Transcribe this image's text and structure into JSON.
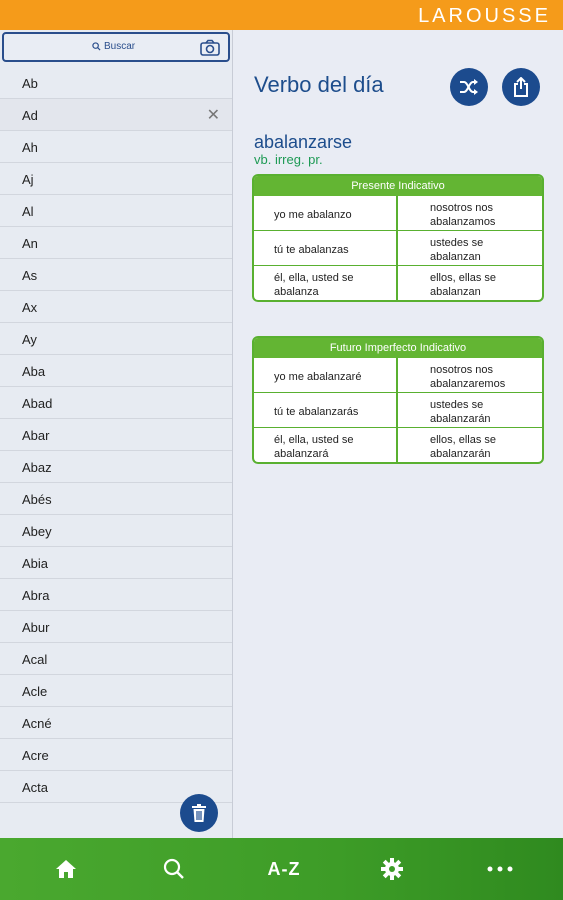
{
  "header": {
    "brand": "LAROUSSE"
  },
  "search": {
    "placeholder": "Buscar"
  },
  "sidebar": {
    "items": [
      {
        "label": "Ab"
      },
      {
        "label": "Ad"
      },
      {
        "label": "Ah"
      },
      {
        "label": "Aj"
      },
      {
        "label": "Al"
      },
      {
        "label": "An"
      },
      {
        "label": "As"
      },
      {
        "label": "Ax"
      },
      {
        "label": "Ay"
      },
      {
        "label": "Aba"
      },
      {
        "label": "Abad"
      },
      {
        "label": "Abar"
      },
      {
        "label": "Abaz"
      },
      {
        "label": "Abés"
      },
      {
        "label": "Abey"
      },
      {
        "label": "Abia"
      },
      {
        "label": "Abra"
      },
      {
        "label": "Abur"
      },
      {
        "label": "Acal"
      },
      {
        "label": "Acle"
      },
      {
        "label": "Acné"
      },
      {
        "label": "Acre"
      },
      {
        "label": "Acta"
      }
    ]
  },
  "main": {
    "title": "Verbo del día",
    "word": "abalanzarse",
    "grammar": "vb. irreg. pr.",
    "tables": [
      {
        "header": "Presente Indicativo",
        "rows": [
          [
            "yo me abalanzo",
            "nosotros nos abalanzamos"
          ],
          [
            "tú te abalanzas",
            "ustedes se abalanzan"
          ],
          [
            "él, ella, usted se abalanza",
            "ellos, ellas se abalanzan"
          ]
        ]
      },
      {
        "header": "Futuro Imperfecto Indicativo",
        "rows": [
          [
            "yo me abalanzaré",
            "nosotros nos abalanzaremos"
          ],
          [
            "tú te abalanzarás",
            "ustedes se abalanzarán"
          ],
          [
            "él, ella, usted se abalanzará",
            "ellos, ellas se abalanzarán"
          ]
        ]
      }
    ]
  },
  "nav": {
    "az_label": "A-Z"
  },
  "icons": [
    "search-icon",
    "camera-icon",
    "close-icon",
    "trash-icon",
    "shuffle-icon",
    "share-icon",
    "home-icon",
    "gear-icon",
    "more-icon"
  ],
  "colors": {
    "brand_orange": "#f59b1a",
    "primary_blue": "#1c4b8e",
    "accent_green": "#63b533"
  }
}
